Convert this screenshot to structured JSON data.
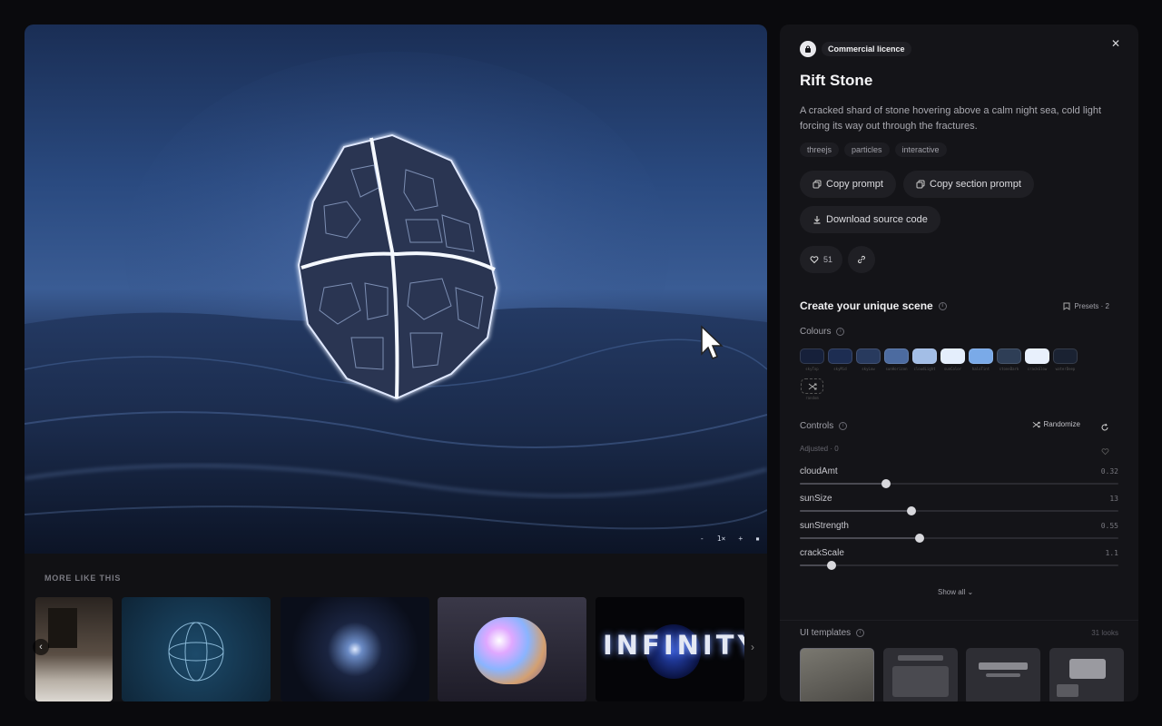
{
  "app": {
    "license_label": "Commercial licence",
    "title": "Rift Stone",
    "description": "A cracked shard of stone hovering above a calm night sea, cold light forcing its way out through the fractures.",
    "tags": [
      "threejs",
      "particles",
      "interactive"
    ],
    "copy_prompt_label": "Copy prompt",
    "copy_section_prompt_label": "Copy section prompt",
    "download_label": "Download source code",
    "likes_count": "51"
  },
  "player": {
    "speed_label": "1×",
    "minus_label": "-",
    "plus_label": "+"
  },
  "more": {
    "title": "MORE LIKE THIS",
    "infinity_text": "INFINITY"
  },
  "scene": {
    "title": "Create your unique scene",
    "presets_label": "Presets · 2",
    "colours_label": "Colours",
    "swatches": [
      {
        "name": "skyTop",
        "color": "#16203a"
      },
      {
        "name": "skyMid",
        "color": "#1d2d52"
      },
      {
        "name": "skyLow",
        "color": "#283a5e"
      },
      {
        "name": "sunHorizon",
        "color": "#4c6ba0"
      },
      {
        "name": "cloudLight",
        "color": "#a3bee6"
      },
      {
        "name": "sunColor",
        "color": "#e4eefc"
      },
      {
        "name": "haloTint",
        "color": "#7aaae8"
      },
      {
        "name": "stoneDark",
        "color": "#2e3e56"
      },
      {
        "name": "crackGlow",
        "color": "#e8f0fc"
      },
      {
        "name": "waterDeep",
        "color": "#1a2232"
      }
    ],
    "random_label": "random",
    "controls_label": "Controls",
    "randomize_label": "Randomize",
    "adjusted_label": "Adjusted · 0",
    "sliders": [
      {
        "label": "cloudAmt",
        "value": "0.32",
        "fraction": 0.27
      },
      {
        "label": "sunSize",
        "value": "13",
        "fraction": 0.35
      },
      {
        "label": "sunStrength",
        "value": "0.55",
        "fraction": 0.375
      },
      {
        "label": "crackScale",
        "value": "1.1",
        "fraction": 0.1
      }
    ],
    "show_all_label": "Show all",
    "templates_label": "UI templates",
    "templates_count": "31 looks"
  }
}
